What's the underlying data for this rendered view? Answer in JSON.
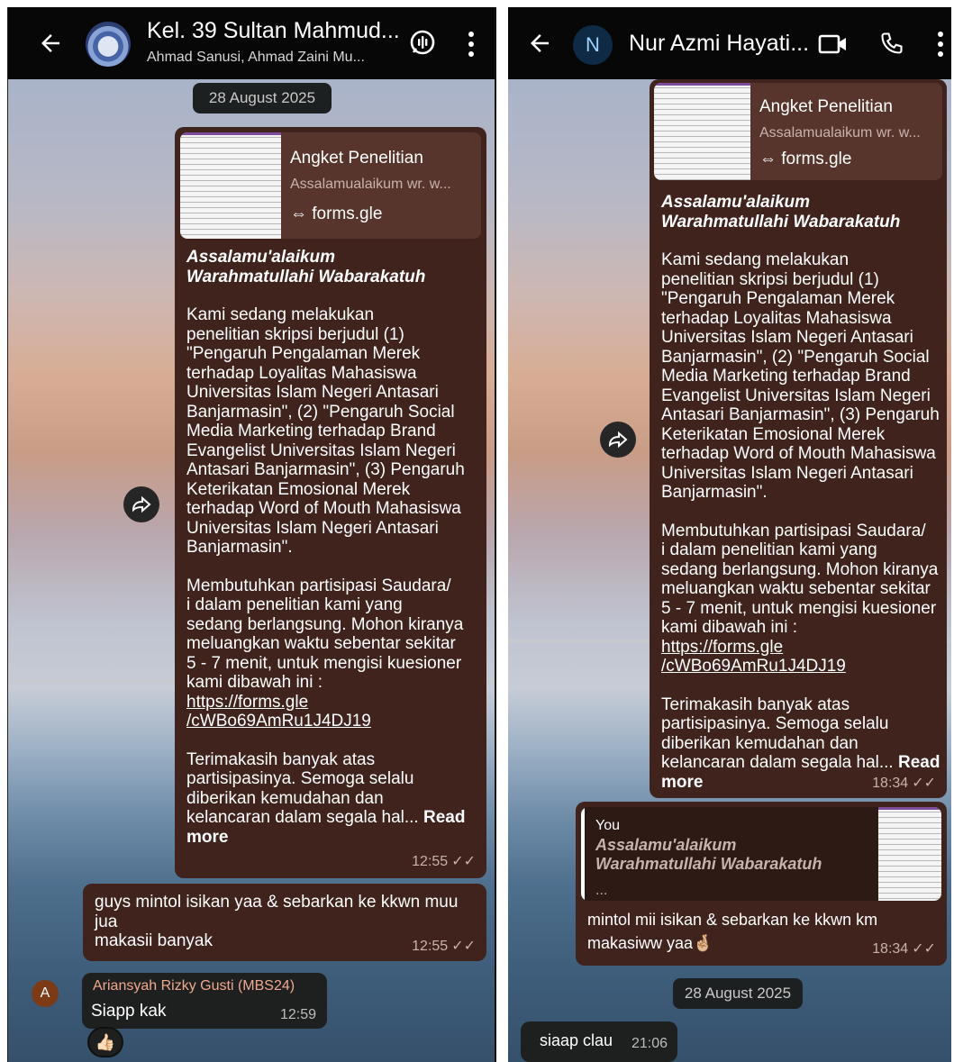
{
  "left_chat": {
    "title": "Kel. 39 Sultan Mahmud...",
    "subtitle": "Ahmad Sanusi, Ahmad Zaini Mu...",
    "date_chip": "28 August 2025",
    "link_preview": {
      "title": "Angket Penelitian",
      "description": "Assalamualaikum wr. w...",
      "domain": "forms.gle"
    },
    "message_body": {
      "greeting": "Assalamu'alaikum Warahmatullahi Wabarakatuh",
      "paragraph1": "Kami sedang melakukan\npenelitian skripsi berjudul (1)\n\"Pengaruh Pengalaman Merek\nterhadap Loyalitas Mahasiswa\nUniversitas Islam Negeri Antasari\nBanjarmasin\", (2) \"Pengaruh Social\nMedia Marketing terhadap Brand\nEvangelist Universitas Islam Negeri\nAntasari Banjarmasin\", (3) Pengaruh\nKeterikatan Emosional Merek\nterhadap Word of Mouth Mahasiswa\nUniversitas Islam Negeri Antasari\nBanjarmasin\".",
      "paragraph2": "Membutuhkan partisipasi Saudara/\ni dalam penelitian kami yang\nsedang berlangsung. Mohon kiranya\nmeluangkan waktu sebentar sekitar\n5 - 7 menit, untuk mengisi kuesioner\nkami dibawah ini :",
      "link_line1": "https://forms.gle",
      "link_line2": "/cWBo69AmRu1J4DJ19",
      "paragraph3": "Terimakasih banyak atas\npartisipasinya. Semoga selalu\ndiberikan kemudahan dan\nkelancaran dalam segala hal...",
      "read_more": "Read",
      "read_more2": "more",
      "time": "12:55"
    },
    "followup": {
      "text": "guys mintol isikan yaa & sebarkan ke kkwn muu\njua\nmakasii banyak",
      "time": "12:55"
    },
    "reply": {
      "avatar_letter": "A",
      "sender": "Ariansyah Rizky Gusti (MBS24)",
      "text": "Siapp kak",
      "time": "12:59",
      "reaction": "👍🏻"
    }
  },
  "right_chat": {
    "avatar_letter": "N",
    "title": "Nur Azmi Hayati...",
    "link_preview": {
      "title": "Angket Penelitian",
      "description": "Assalamualaikum wr. w...",
      "domain": "forms.gle"
    },
    "message_body": {
      "greeting": "Assalamu'alaikum Warahmatullahi Wabarakatuh",
      "paragraph1": "Kami sedang melakukan\npenelitian skripsi berjudul (1)\n\"Pengaruh Pengalaman Merek\nterhadap Loyalitas Mahasiswa\nUniversitas Islam Negeri Antasari\nBanjarmasin\", (2) \"Pengaruh Social\nMedia Marketing terhadap Brand\nEvangelist Universitas Islam Negeri\nAntasari Banjarmasin\", (3) Pengaruh\nKeterikatan Emosional Merek\nterhadap Word of Mouth Mahasiswa\nUniversitas Islam Negeri Antasari\nBanjarmasin\".",
      "paragraph2": "Membutuhkan partisipasi Saudara/\ni dalam penelitian kami yang\nsedang berlangsung. Mohon kiranya\nmeluangkan waktu sebentar sekitar\n5 - 7 menit, untuk mengisi kuesioner\nkami dibawah ini :",
      "link_line1": "https://forms.gle",
      "link_line2": "/cWBo69AmRu1J4DJ19",
      "paragraph3": "Terimakasih banyak atas\npartisipasinya. Semoga selalu\ndiberikan kemudahan dan\nkelancaran dalam segala hal...",
      "read_more": "Read",
      "read_more2": "more",
      "time": "18:34"
    },
    "quoted_reply": {
      "author": "You",
      "quote": "Assalamu'alaikum Warahmatullahi Wabarakatuh",
      "ellipsis": "...",
      "text": "mintol mii isikan & sebarkan ke kkwn km\nmakasiww yaa",
      "emoji": "🤞🏼",
      "time": "18:34"
    },
    "date_chip": "28 August 2025",
    "incoming": {
      "text": "siaap clau",
      "time": "21:06"
    }
  },
  "colors": {
    "outgoing_bubble": "#3f231c",
    "incoming_bubble": "#1e1f1f",
    "topbar": "#070707"
  }
}
